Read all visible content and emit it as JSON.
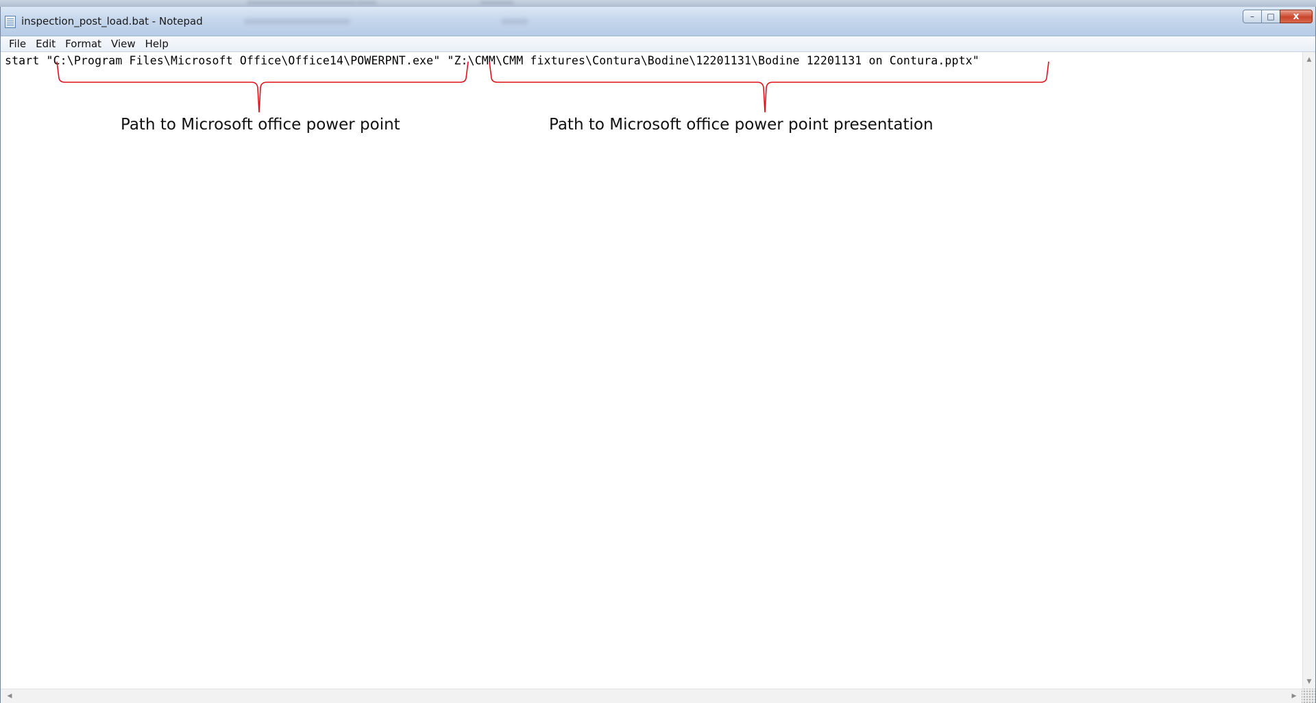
{
  "window": {
    "title": "inspection_post_load.bat - Notepad",
    "caption_buttons": {
      "minimize": "–",
      "maximize": "□",
      "close": "x"
    }
  },
  "menu": [
    "File",
    "Edit",
    "Format",
    "View",
    "Help"
  ],
  "editor": {
    "content": "start \"C:\\Program Files\\Microsoft Office\\Office14\\POWERPNT.exe\" \"Z:\\CMM\\CMM fixtures\\Contura\\Bodine\\12201131\\Bodine 12201131 on Contura.pptx\""
  },
  "annotations": {
    "left_label": "Path to Microsoft office power point",
    "right_label": "Path to Microsoft office power point presentation",
    "brace_color": "#e0101a"
  },
  "scrollbars": {
    "up_arrow": "▲",
    "down_arrow": "▼",
    "left_arrow": "◀",
    "right_arrow": "▶"
  }
}
